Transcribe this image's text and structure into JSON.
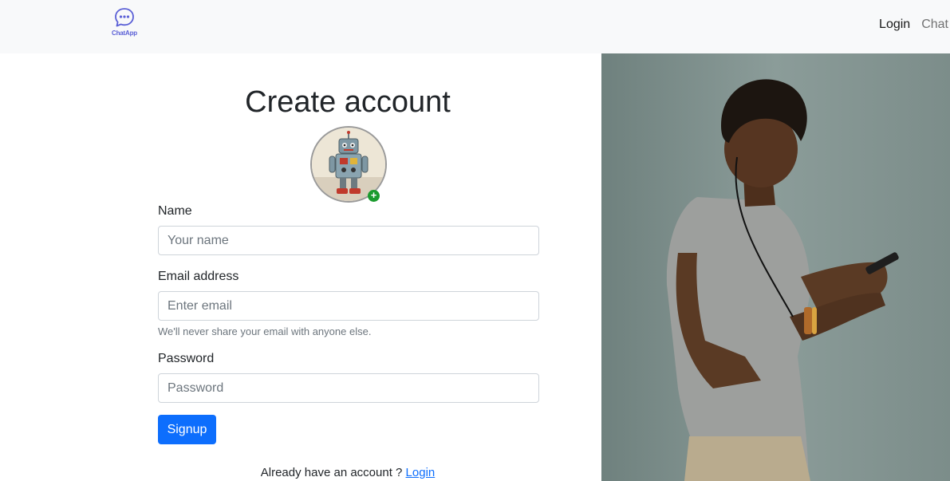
{
  "navbar": {
    "brand_text": "ChatApp",
    "links": [
      {
        "label": "Login",
        "active": true
      },
      {
        "label": "Chat",
        "active": false
      }
    ]
  },
  "form": {
    "title": "Create account",
    "avatar_badge": "+",
    "name": {
      "label": "Name",
      "placeholder": "Your name",
      "value": ""
    },
    "email": {
      "label": "Email address",
      "placeholder": "Enter email",
      "value": "",
      "help": "We'll never share your email with anyone else."
    },
    "password": {
      "label": "Password",
      "placeholder": "Password",
      "value": ""
    },
    "submit_label": "Signup",
    "footer_text": "Already have an account ?",
    "footer_link": "Login"
  },
  "colors": {
    "navbar_bg": "#f8f9fa",
    "primary": "#0d6efd",
    "badge": "#1a9b2e",
    "brand": "#5a5fd6"
  },
  "icons": [
    "chat-bubble-icon",
    "plus-icon"
  ]
}
